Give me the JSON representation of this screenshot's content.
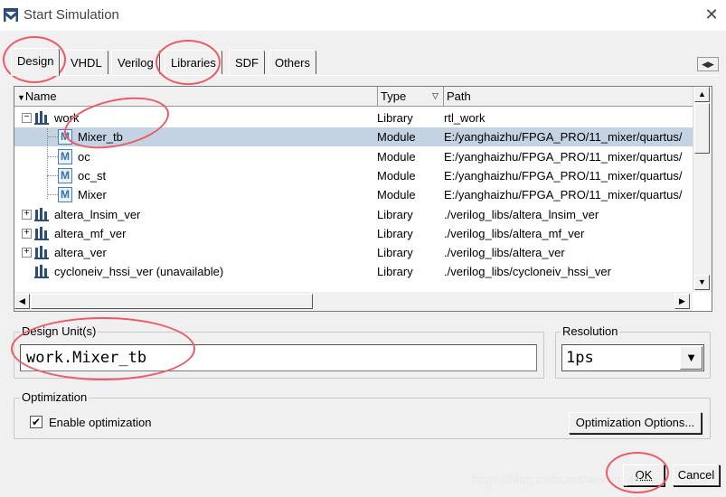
{
  "window": {
    "title": "Start Simulation",
    "close_label": "✕"
  },
  "tabs": [
    "Design",
    "VHDL",
    "Verilog",
    "Libraries",
    "SDF",
    "Others"
  ],
  "list": {
    "columns": [
      "Name",
      "Type",
      "Path"
    ],
    "rows": [
      {
        "name": "work",
        "type": "Library",
        "path": "rtl_work",
        "kind": "library",
        "expander": "−",
        "indent": 0
      },
      {
        "name": "Mixer_tb",
        "type": "Module",
        "path": "E:/yanghaizhu/FPGA_PRO/11_mixer/quartus/",
        "kind": "module",
        "indent": 1,
        "selected": true
      },
      {
        "name": "oc",
        "type": "Module",
        "path": "E:/yanghaizhu/FPGA_PRO/11_mixer/quartus/",
        "kind": "module",
        "indent": 1
      },
      {
        "name": "oc_st",
        "type": "Module",
        "path": "E:/yanghaizhu/FPGA_PRO/11_mixer/quartus/",
        "kind": "module",
        "indent": 1
      },
      {
        "name": "Mixer",
        "type": "Module",
        "path": "E:/yanghaizhu/FPGA_PRO/11_mixer/quartus/",
        "kind": "module",
        "indent": 1
      },
      {
        "name": "altera_lnsim_ver",
        "type": "Library",
        "path": "./verilog_libs/altera_lnsim_ver",
        "kind": "library",
        "expander": "+",
        "indent": 0
      },
      {
        "name": "altera_mf_ver",
        "type": "Library",
        "path": "./verilog_libs/altera_mf_ver",
        "kind": "library",
        "expander": "+",
        "indent": 0
      },
      {
        "name": "altera_ver",
        "type": "Library",
        "path": "./verilog_libs/altera_ver",
        "kind": "library",
        "expander": "+",
        "indent": 0
      },
      {
        "name": "cycloneiv_hssi_ver  (unavailable)",
        "type": "Library",
        "path": "./verilog_libs/cycloneiv_hssi_ver",
        "kind": "library",
        "indent": 0
      }
    ]
  },
  "design_unit": {
    "label": "Design Unit(s)",
    "value": "work.Mixer_tb"
  },
  "resolution": {
    "label": "Resolution",
    "value": "1ps"
  },
  "optimization": {
    "label": "Optimization",
    "checkbox_label": "Enable optimization",
    "checked": true,
    "options_button": "Optimization Options..."
  },
  "buttons": {
    "ok": "OK",
    "cancel": "Cancel"
  },
  "watermark": "https://blog.csdn.net/weixin_44...",
  "colors": {
    "selection": "#c3d3e3",
    "annotation": "#ee5a64"
  }
}
